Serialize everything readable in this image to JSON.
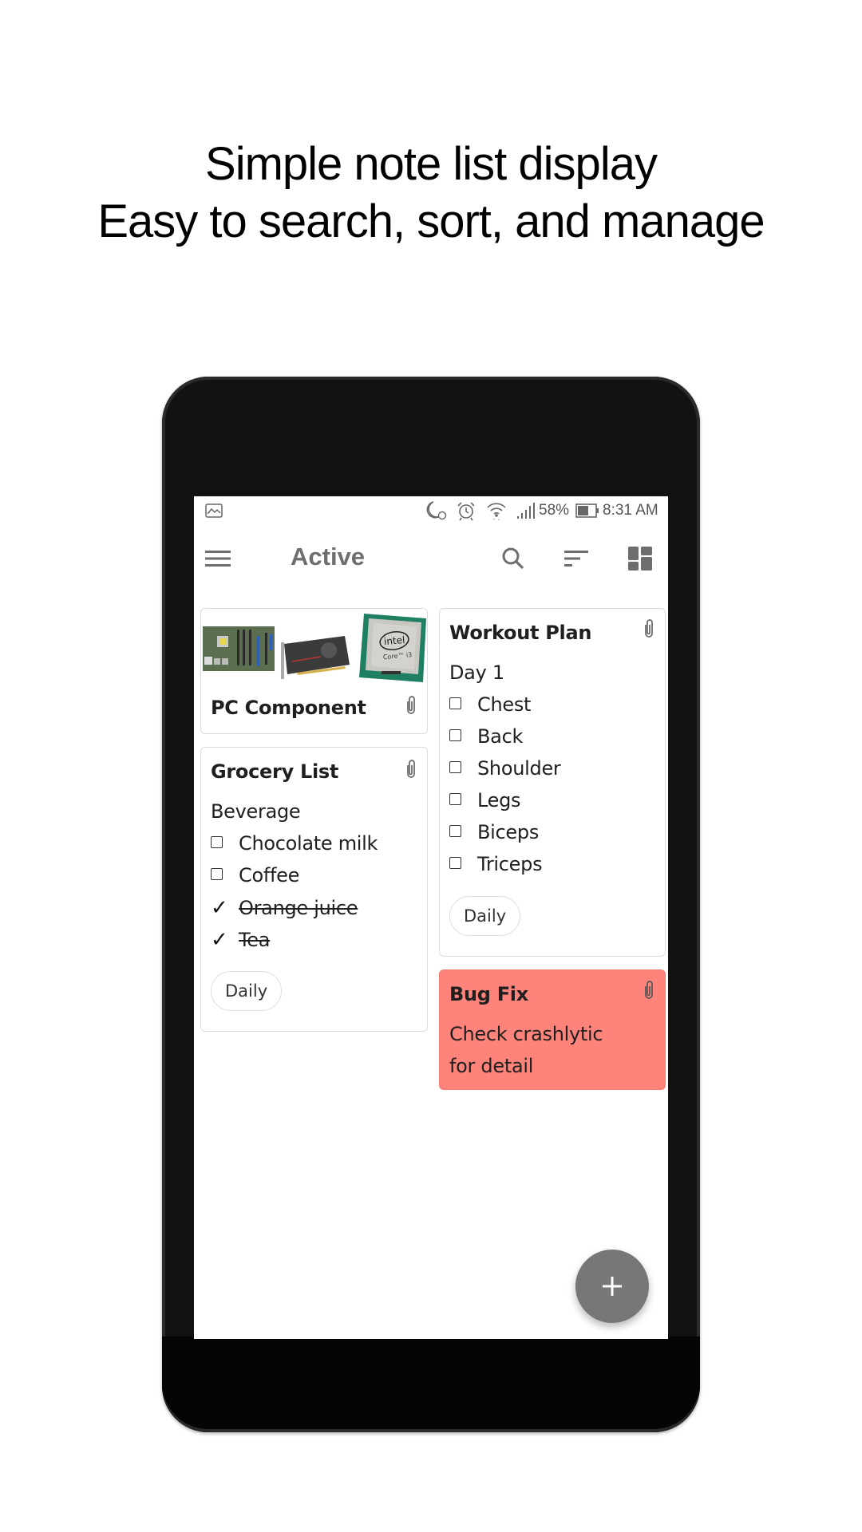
{
  "headline": {
    "line1": "Simple note list display",
    "line2": "Easy to search, sort, and manage"
  },
  "statusbar": {
    "icons": [
      "gallery-notification-icon",
      "night-alarm-icon",
      "alarm-clock-icon",
      "wifi-icon",
      "signal-icon",
      "battery-icon"
    ],
    "battery_percent": "58%",
    "time": "8:31 AM"
  },
  "appbar": {
    "title": "Active",
    "icons": [
      "menu-icon",
      "search-icon",
      "sort-icon",
      "layout-grid-icon"
    ]
  },
  "notes": [
    {
      "title": "PC Component",
      "has_attachment": true,
      "images": [
        "motherboard",
        "graphics-card",
        "intel-core-i3-cpu"
      ],
      "cpu_label_brand": "intel",
      "cpu_label_model": "Core™ i3",
      "color": "#ffffff"
    },
    {
      "title": "Grocery List",
      "has_attachment": true,
      "color": "#ffffff",
      "heading": "Beverage",
      "items": [
        {
          "text": "Chocolate milk",
          "checked": false
        },
        {
          "text": "Coffee",
          "checked": false
        },
        {
          "text": "Orange juice",
          "checked": true
        },
        {
          "text": "Tea",
          "checked": true
        }
      ],
      "label": "Daily"
    },
    {
      "title": "Workout Plan",
      "has_attachment": true,
      "color": "#ffffff",
      "heading": "Day 1",
      "items": [
        {
          "text": "Chest",
          "checked": false
        },
        {
          "text": "Back",
          "checked": false
        },
        {
          "text": "Shoulder",
          "checked": false
        },
        {
          "text": "Legs",
          "checked": false
        },
        {
          "text": "Biceps",
          "checked": false
        },
        {
          "text": "Triceps",
          "checked": false
        }
      ],
      "label": "Daily"
    },
    {
      "title": "Bug Fix",
      "has_attachment": true,
      "color": "#fe847b",
      "body_lines": [
        "Check crashlytic",
        "for detail"
      ]
    }
  ],
  "fab": {
    "icon": "plus-icon"
  },
  "colors": {
    "appbar_icon": "#6e6e6e",
    "fab": "#777777",
    "red_note": "#fe847b"
  }
}
